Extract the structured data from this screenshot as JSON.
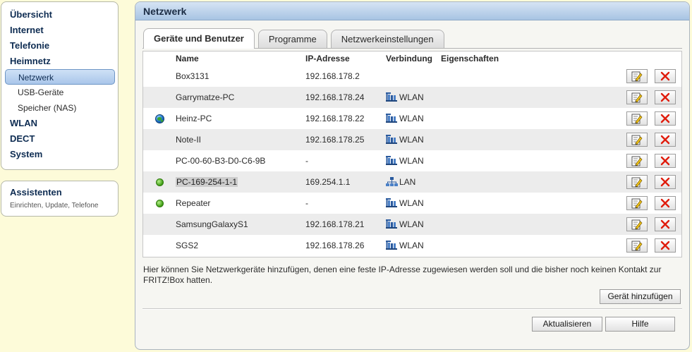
{
  "nav": {
    "items": [
      {
        "label": "Übersicht",
        "level": "top"
      },
      {
        "label": "Internet",
        "level": "top"
      },
      {
        "label": "Telefonie",
        "level": "top"
      },
      {
        "label": "Heimnetz",
        "level": "top"
      },
      {
        "label": "Netzwerk",
        "level": "sub",
        "active": true
      },
      {
        "label": "USB-Geräte",
        "level": "sub"
      },
      {
        "label": "Speicher (NAS)",
        "level": "sub"
      },
      {
        "label": "WLAN",
        "level": "top"
      },
      {
        "label": "DECT",
        "level": "top"
      },
      {
        "label": "System",
        "level": "top"
      }
    ]
  },
  "assistants": {
    "title": "Assistenten",
    "subtitle": "Einrichten, Update, Telefone"
  },
  "panel": {
    "title": "Netzwerk",
    "tabs": [
      {
        "label": "Geräte und Benutzer",
        "active": true
      },
      {
        "label": "Programme"
      },
      {
        "label": "Netzwerkeinstellungen"
      }
    ]
  },
  "table": {
    "headers": {
      "name": "Name",
      "ip": "IP-Adresse",
      "connection": "Verbindung",
      "properties": "Eigenschaften"
    },
    "rows": [
      {
        "status": "none",
        "name": "Box3131",
        "ip": "192.168.178.2",
        "connection": "",
        "conn_icon": "none"
      },
      {
        "status": "none",
        "name": "Garrymatze-PC",
        "ip": "192.168.178.24",
        "connection": "WLAN",
        "conn_icon": "wlan-icon"
      },
      {
        "status": "globe",
        "name": "Heinz-PC",
        "ip": "192.168.178.22",
        "connection": "WLAN",
        "conn_icon": "wlan-icon"
      },
      {
        "status": "none",
        "name": "Note-II",
        "ip": "192.168.178.25",
        "connection": "WLAN",
        "conn_icon": "wlan-icon"
      },
      {
        "status": "none",
        "name": "PC-00-60-B3-D0-C6-9B",
        "ip": "-",
        "connection": "WLAN",
        "conn_icon": "wlan-icon"
      },
      {
        "status": "online",
        "name": "PC-169-254-1-1",
        "ip": "169.254.1.1",
        "connection": "LAN",
        "conn_icon": "lan-icon",
        "highlighted": true
      },
      {
        "status": "online",
        "name": "Repeater",
        "ip": "-",
        "connection": "WLAN",
        "conn_icon": "wlan-icon"
      },
      {
        "status": "none",
        "name": "SamsungGalaxyS1",
        "ip": "192.168.178.21",
        "connection": "WLAN",
        "conn_icon": "wlan-icon"
      },
      {
        "status": "none",
        "name": "SGS2",
        "ip": "192.168.178.26",
        "connection": "WLAN",
        "conn_icon": "wlan-icon"
      }
    ]
  },
  "info_text": "Hier können Sie Netzwerkgeräte hinzufügen, denen eine feste IP-Adresse zugewiesen werden soll und die bisher noch keinen Kontakt zur FRITZ!Box hatten.",
  "buttons": {
    "add_device": "Gerät hinzufügen",
    "refresh": "Aktualisieren",
    "help": "Hilfe"
  },
  "colors": {
    "background": "#fdfbd9",
    "header": "#a8c4e3",
    "active_nav": "#a9c6ea",
    "delete": "#e01c0c",
    "online": "#3c9b12"
  }
}
